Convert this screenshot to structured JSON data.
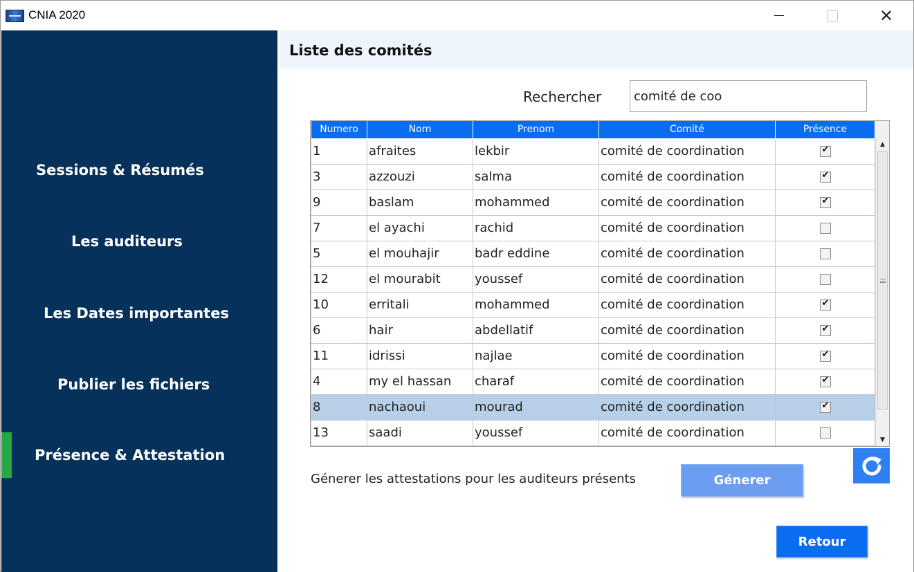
{
  "window": {
    "title": "CNIA 2020",
    "controls": {
      "minimize": "—",
      "maximize": "☐",
      "close": "✕"
    }
  },
  "sidebar": {
    "items": [
      {
        "label": "Sessions & Résumés",
        "active": false
      },
      {
        "label": "Les auditeurs",
        "active": false
      },
      {
        "label": "Les Dates importantes",
        "active": false
      },
      {
        "label": "Publier les fichiers",
        "active": false
      },
      {
        "label": "Présence & Attestation",
        "active": true
      }
    ],
    "active_color": "#27a844",
    "background": "#06315a"
  },
  "main": {
    "title": "Liste des comités",
    "search": {
      "label": "Rechercher",
      "value": "comité de coo"
    },
    "table": {
      "columns": [
        "Numero",
        "Nom",
        "Prenom",
        "Comité",
        "Présence"
      ],
      "rows": [
        {
          "numero": "1",
          "nom": "afraites",
          "prenom": "lekbir",
          "comite": "comité de coordination",
          "presence": true,
          "selected": false
        },
        {
          "numero": "3",
          "nom": "azzouzi",
          "prenom": "salma",
          "comite": "comité de coordination",
          "presence": true,
          "selected": false
        },
        {
          "numero": "9",
          "nom": "baslam",
          "prenom": "mohammed",
          "comite": "comité de coordination",
          "presence": true,
          "selected": false
        },
        {
          "numero": "7",
          "nom": "el ayachi",
          "prenom": "rachid",
          "comite": "comité de coordination",
          "presence": false,
          "selected": false
        },
        {
          "numero": "5",
          "nom": "el mouhajir",
          "prenom": "badr eddine",
          "comite": "comité de coordination",
          "presence": false,
          "selected": false
        },
        {
          "numero": "12",
          "nom": "el mourabit",
          "prenom": " youssef",
          "comite": "comité de coordination",
          "presence": false,
          "selected": false
        },
        {
          "numero": "10",
          "nom": "erritali",
          "prenom": "mohammed",
          "comite": "comité de coordination",
          "presence": true,
          "selected": false
        },
        {
          "numero": "6",
          "nom": "hair",
          "prenom": "abdellatif",
          "comite": "comité de coordination",
          "presence": true,
          "selected": false
        },
        {
          "numero": "11",
          "nom": "idrissi",
          "prenom": "najlae",
          "comite": "comité de coordination",
          "presence": true,
          "selected": false
        },
        {
          "numero": "4",
          "nom": "my el hassan",
          "prenom": "charaf",
          "comite": "comité de coordination",
          "presence": true,
          "selected": false
        },
        {
          "numero": "8",
          "nom": "nachaoui",
          "prenom": "mourad",
          "comite": "comité de coordination",
          "presence": true,
          "selected": true
        },
        {
          "numero": "13",
          "nom": "saadi",
          "prenom": " youssef",
          "comite": "comité de coordination",
          "presence": false,
          "selected": false
        }
      ],
      "header_color": "#0a6df0",
      "selected_color": "#b8cfe8"
    },
    "refresh_icon": "refresh-icon",
    "generate": {
      "label": "Génerer les attestations pour les auditeurs présents",
      "button": "Génerer"
    },
    "back_button": "Retour"
  }
}
